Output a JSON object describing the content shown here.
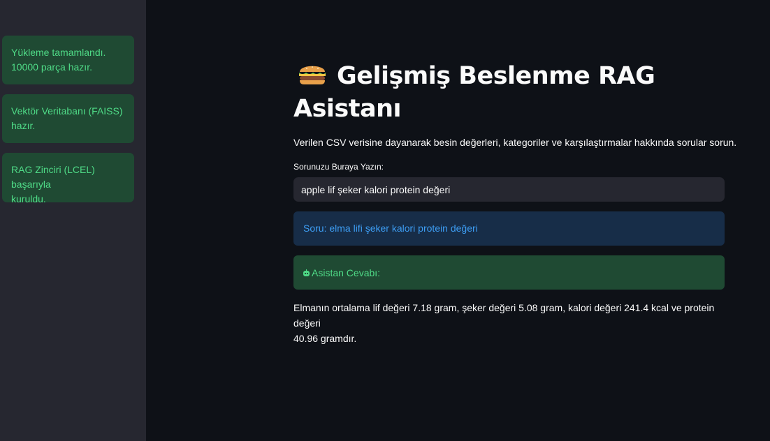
{
  "sidebar": {
    "alerts": [
      {
        "line1": "Yükleme tamamlandı.",
        "line2": "10000 parça hazır."
      },
      {
        "line1": "Vektör Veritabanı (FAISS)",
        "line2": "hazır."
      },
      {
        "line1": "RAG Zinciri (LCEL) başarıyla",
        "line2": "kuruldu."
      }
    ]
  },
  "main": {
    "title_line1": "Gelişmiş Beslenme RAG",
    "title_line2": "Asistanı",
    "title_icon": "burger-icon",
    "description": "Verilen CSV verisine dayanarak besin değerleri, kategoriler ve karşılaştırmalar hakkında sorular sorun.",
    "input_label": "Sorunuzu Buraya Yazın:",
    "input_value": "apple lif şeker kalori protein değeri",
    "info_text": "Soru: elma lifi şeker kalori protein değeri",
    "success_text": "Asistan Cevabı:",
    "success_icon": "robot-icon",
    "answer_line1": "Elmanın ortalama lif değeri 7.18 gram, şeker değeri 5.08 gram, kalori değeri 241.4 kcal ve protein değeri",
    "answer_line2": "40.96 gramdır."
  },
  "colors": {
    "background": "#0e1117",
    "sidebar": "#262730",
    "success_bg": "#1f4a33",
    "success_text": "#4fdb87",
    "info_bg": "#172d48",
    "info_text": "#3d9df3"
  }
}
